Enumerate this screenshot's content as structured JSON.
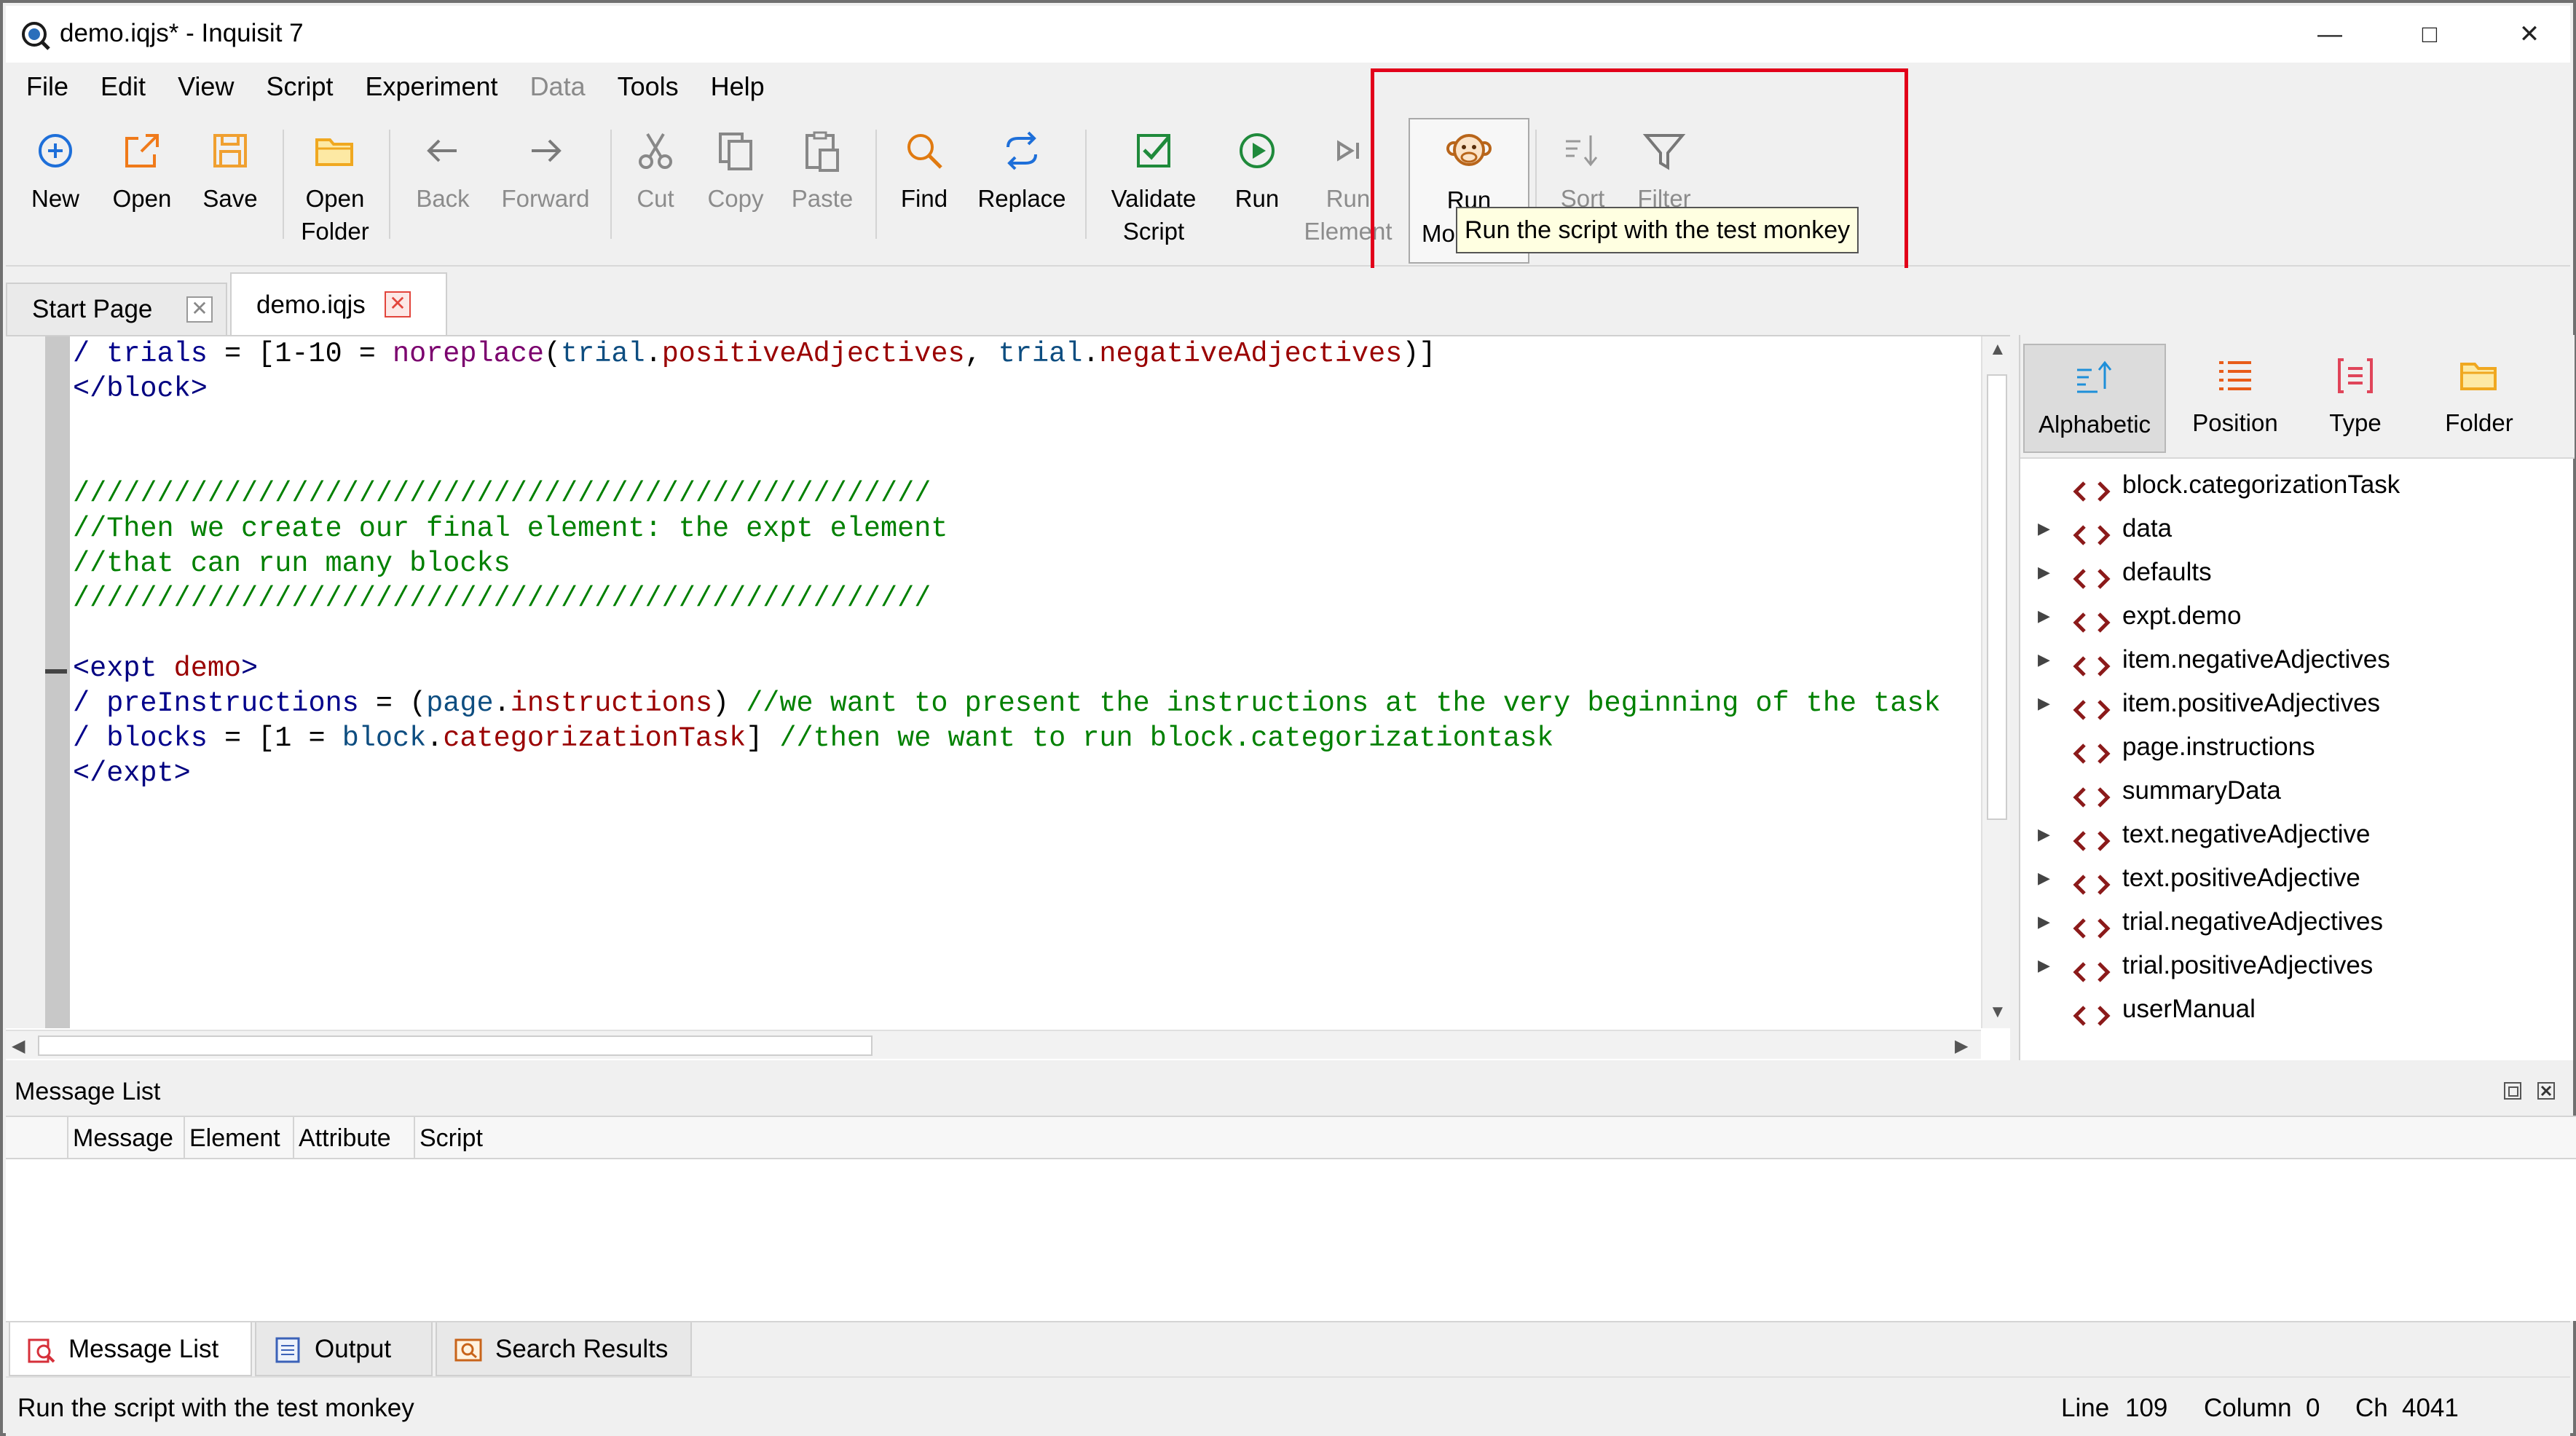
{
  "window": {
    "title": "demo.iqjs* - Inquisit 7",
    "minimize": "—",
    "maximize": "□",
    "close": "✕"
  },
  "menu": [
    "File",
    "Edit",
    "View",
    "Script",
    "Experiment",
    "Data",
    "Tools",
    "Help"
  ],
  "toolbar": {
    "new": "New",
    "open": "Open",
    "save": "Save",
    "open_folder": "Open\nFolder",
    "back": "Back",
    "forward": "Forward",
    "cut": "Cut",
    "copy": "Copy",
    "paste": "Paste",
    "find": "Find",
    "replace": "Replace",
    "validate": "Validate\nScript",
    "run": "Run",
    "run_element": "Run\nElement",
    "run_monkey_partial": "Run",
    "run_monkey_partial2": "Mo",
    "sort": "Sort",
    "filter": "Filter"
  },
  "tooltip": "Run the script with the test monkey",
  "tabs": {
    "start_page": "Start Page",
    "demo": "demo.iqjs",
    "close_glyph": "✕"
  },
  "code_lines": [
    [
      {
        "t": "/ ",
        "c": "k"
      },
      {
        "t": "trials",
        "c": "k"
      },
      {
        "t": " = [1-10 = ",
        "c": ""
      },
      {
        "t": "noreplace",
        "c": "fn"
      },
      {
        "t": "(",
        "c": ""
      },
      {
        "t": "trial",
        "c": "obj"
      },
      {
        "t": ".",
        "c": ""
      },
      {
        "t": "positiveAdjectives",
        "c": "nm"
      },
      {
        "t": ", ",
        "c": ""
      },
      {
        "t": "trial",
        "c": "obj"
      },
      {
        "t": ".",
        "c": ""
      },
      {
        "t": "negativeAdjectives",
        "c": "nm"
      },
      {
        "t": ")]",
        "c": ""
      }
    ],
    [
      {
        "t": "</block>",
        "c": "tag"
      }
    ],
    [],
    [],
    [
      {
        "t": "///////////////////////////////////////////////////",
        "c": "cm"
      }
    ],
    [
      {
        "t": "//Then we create our final element: the expt element",
        "c": "cm"
      }
    ],
    [
      {
        "t": "//that can run many blocks",
        "c": "cm"
      }
    ],
    [
      {
        "t": "///////////////////////////////////////////////////",
        "c": "cm"
      }
    ],
    [],
    [
      {
        "t": "<expt ",
        "c": "tag"
      },
      {
        "t": "demo",
        "c": "nm"
      },
      {
        "t": ">",
        "c": "tag"
      }
    ],
    [
      {
        "t": "/ ",
        "c": "k"
      },
      {
        "t": "preInstructions",
        "c": "k"
      },
      {
        "t": " = (",
        "c": ""
      },
      {
        "t": "page",
        "c": "obj"
      },
      {
        "t": ".",
        "c": ""
      },
      {
        "t": "instructions",
        "c": "nm"
      },
      {
        "t": ") ",
        "c": ""
      },
      {
        "t": "//we want to present the instructions at the very beginning of the task",
        "c": "cm"
      }
    ],
    [
      {
        "t": "/ ",
        "c": "k"
      },
      {
        "t": "blocks",
        "c": "k"
      },
      {
        "t": " = [1 = ",
        "c": ""
      },
      {
        "t": "block",
        "c": "obj"
      },
      {
        "t": ".",
        "c": ""
      },
      {
        "t": "categorizationTask",
        "c": "nm"
      },
      {
        "t": "] ",
        "c": ""
      },
      {
        "t": "//then we want to run block.categorizationtask",
        "c": "cm"
      }
    ],
    [
      {
        "t": "</expt>",
        "c": "tag"
      }
    ]
  ],
  "right_panel": {
    "buttons": [
      "Alphabetic",
      "Position",
      "Type",
      "Folder"
    ],
    "tree": [
      {
        "label": "block.categorizationTask",
        "expandable": false
      },
      {
        "label": "data",
        "expandable": true
      },
      {
        "label": "defaults",
        "expandable": true
      },
      {
        "label": "expt.demo",
        "expandable": true
      },
      {
        "label": "item.negativeAdjectives",
        "expandable": true
      },
      {
        "label": "item.positiveAdjectives",
        "expandable": true
      },
      {
        "label": "page.instructions",
        "expandable": false
      },
      {
        "label": "summaryData",
        "expandable": false
      },
      {
        "label": "text.negativeAdjective",
        "expandable": true
      },
      {
        "label": "text.positiveAdjective",
        "expandable": true
      },
      {
        "label": "trial.negativeAdjectives",
        "expandable": true
      },
      {
        "label": "trial.positiveAdjectives",
        "expandable": true
      },
      {
        "label": "userManual",
        "expandable": false
      }
    ]
  },
  "message_list": {
    "title": "Message List",
    "columns": [
      "Message",
      "Element",
      "Attribute",
      "Script"
    ]
  },
  "bottom_tabs": [
    "Message List",
    "Output",
    "Search Results"
  ],
  "status": {
    "text": "Run the script with the test monkey",
    "line_label": "Line",
    "line": "109",
    "column_label": "Column",
    "column": "0",
    "ch_label": "Ch",
    "ch": "4041"
  },
  "colors": {
    "highlight": "#e2001a",
    "tooltip_bg": "#ffffe1",
    "comment": "#008000",
    "element_name": "#9a0000"
  }
}
